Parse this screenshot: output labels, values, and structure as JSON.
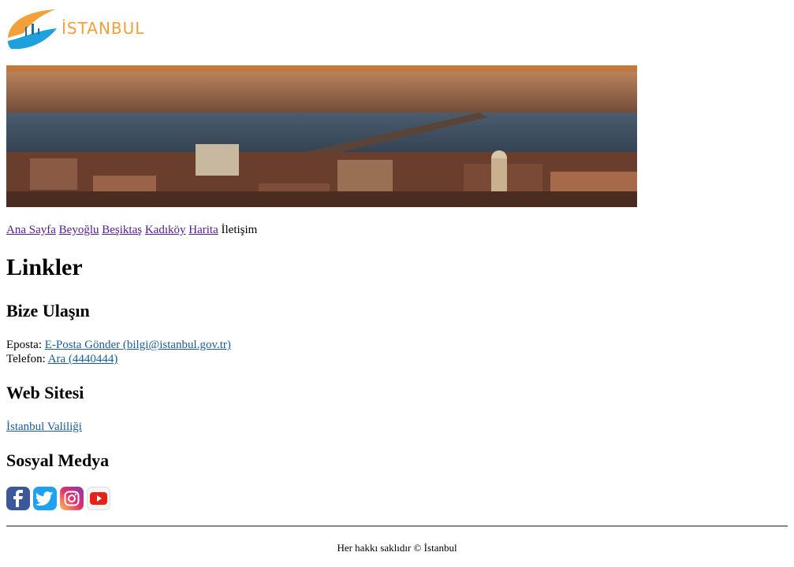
{
  "logo": {
    "text": "İSTANBUL",
    "colors": {
      "orange": "#f2a03a",
      "blue": "#1ea0dc"
    }
  },
  "banner": {
    "alt": "İstanbul manzarası"
  },
  "nav": {
    "items": [
      {
        "label": "Ana Sayfa"
      },
      {
        "label": "Beyoğlu"
      },
      {
        "label": "Beşiktaş"
      },
      {
        "label": "Kadıköy"
      },
      {
        "label": "Harita"
      }
    ],
    "current": "İletişim"
  },
  "page": {
    "title": "Linkler"
  },
  "contact": {
    "heading": "Bize Ulaşın",
    "email_label": "Eposta:",
    "email_link": "E-Posta Gönder (bilgi@istanbul.gov.tr)",
    "phone_label": "Telefon:",
    "phone_link": "Ara (4440444)"
  },
  "web": {
    "heading": "Web Sitesi",
    "link": "İstanbul Valiliği"
  },
  "social": {
    "heading": "Sosyal Medya",
    "icons": [
      "facebook-icon",
      "twitter-icon",
      "instagram-icon",
      "youtube-icon"
    ]
  },
  "footer": {
    "text": "Her hakkı saklıdır © İstanbul"
  }
}
